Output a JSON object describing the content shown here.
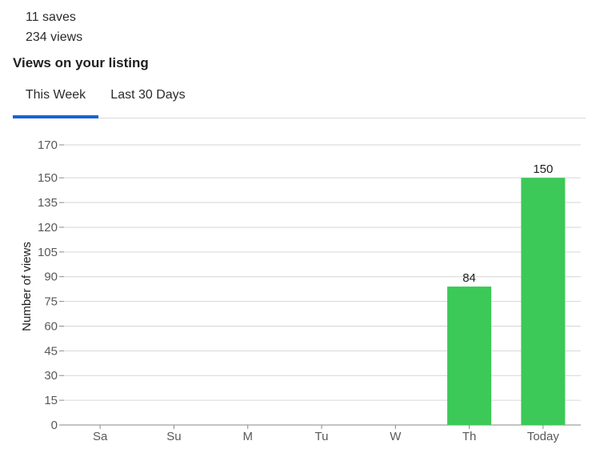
{
  "stats": {
    "saves": "11 saves",
    "views": "234 views"
  },
  "section": {
    "title": "Views on your listing"
  },
  "tabs": [
    {
      "label": "This Week",
      "active": true
    },
    {
      "label": "Last 30 Days",
      "active": false
    }
  ],
  "colors": {
    "bar": "#3cc958",
    "accent": "#1565d8"
  },
  "chart_data": {
    "type": "bar",
    "categories": [
      "Sa",
      "Su",
      "M",
      "Tu",
      "W",
      "Th",
      "Today"
    ],
    "values": [
      0,
      0,
      0,
      0,
      0,
      84,
      150
    ],
    "ylabel": "Number of views",
    "ylim": [
      0,
      170
    ],
    "yticks": [
      0,
      15,
      30,
      45,
      60,
      75,
      90,
      105,
      120,
      135,
      150,
      170
    ],
    "grid": true,
    "data_labels": [
      null,
      null,
      null,
      null,
      null,
      "84",
      "150"
    ]
  }
}
